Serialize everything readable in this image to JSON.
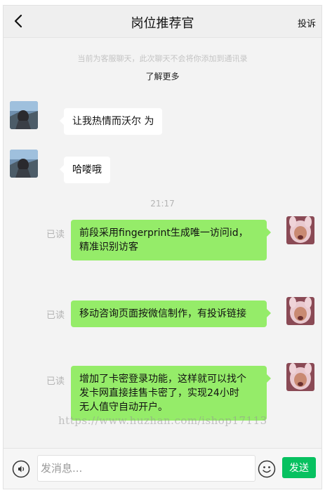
{
  "header": {
    "title": "岗位推荐官",
    "report_label": "投诉"
  },
  "notice": {
    "text": "当前为客服聊天，此次聊天不会将你添加到通讯录",
    "learn_more": "了解更多"
  },
  "messages_in": [
    {
      "text": "让我热情而沃尔 为"
    },
    {
      "text": "哈喽哦"
    }
  ],
  "time_divider": "21:17",
  "messages_out": [
    {
      "status": "已读",
      "lines": [
        "前段采用fingerprint生成唯一访问id，",
        "精准识别访客"
      ]
    },
    {
      "status": "已读",
      "lines": [
        "移动咨询页面按微信制作，有投诉链接"
      ]
    },
    {
      "status": "已读",
      "lines": [
        "增加了卡密登录功能，这样就可以找个",
        "发卡网直接挂售卡密了，实现24小时",
        "无人值守自动开户。"
      ]
    }
  ],
  "watermark": "https://www.huzhan.com/ishop17113",
  "footer": {
    "input_placeholder": "发消息...",
    "send_label": "发送"
  },
  "icons": {
    "back": "chevron-left-icon",
    "voice": "voice-icon",
    "emoji": "emoji-icon"
  },
  "colors": {
    "send_button": "#07c160",
    "outgoing_bubble": "#95ec69",
    "incoming_bubble": "#ffffff"
  }
}
